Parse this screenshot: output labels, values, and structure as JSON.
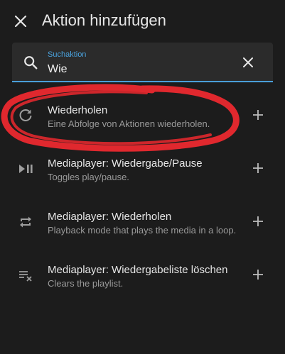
{
  "header": {
    "title": "Aktion hinzufügen",
    "close_icon": "close-icon"
  },
  "search": {
    "label": "Suchaktion",
    "value": "Wie",
    "icon": "search-icon",
    "clear_icon": "clear-icon",
    "accent_color": "#4a9fd9"
  },
  "items": [
    {
      "title": "Wiederholen",
      "description": "Eine Abfolge von Aktionen wiederholen.",
      "icon": "refresh-icon"
    },
    {
      "title": "Mediaplayer: Wiedergabe/Pause",
      "description": "Toggles play/pause.",
      "icon": "play-pause-icon"
    },
    {
      "title": "Mediaplayer: Wiederholen",
      "description": "Playback mode that plays the media in a loop.",
      "icon": "repeat-icon"
    },
    {
      "title": "Mediaplayer: Wiedergabeliste löschen",
      "description": "Clears the playlist.",
      "icon": "playlist-remove-icon"
    }
  ],
  "annotation_color": "#e0282e"
}
